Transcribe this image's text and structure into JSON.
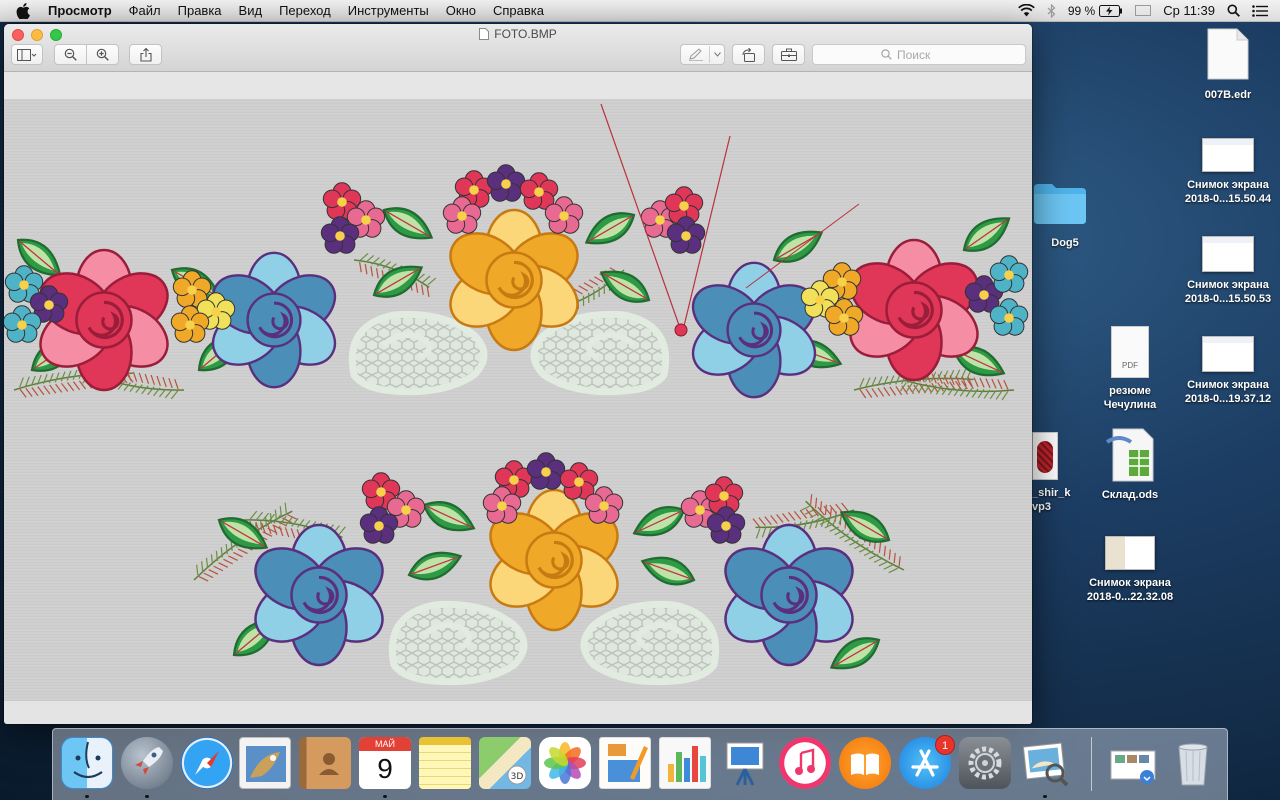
{
  "menubar": {
    "app_name": "Просмотр",
    "items": [
      "Файл",
      "Правка",
      "Вид",
      "Переход",
      "Инструменты",
      "Окно",
      "Справка"
    ],
    "battery": "99 %",
    "clock": "Ср 11:39"
  },
  "window": {
    "title": "FOTO.BMP",
    "search_placeholder": "Поиск"
  },
  "desktop_icons": [
    {
      "label_lines": [
        "007B.edr"
      ]
    },
    {
      "label_lines": [
        "Снимок экрана",
        "2018-0...15.50.44"
      ]
    },
    {
      "label_lines": [
        "Dog5"
      ]
    },
    {
      "label_lines": [
        "Снимок экрана",
        "2018-0...15.50.53"
      ]
    },
    {
      "label_lines": [
        "резюме",
        "Чечулина"
      ],
      "badge": "PDF"
    },
    {
      "label_lines": [
        "Снимок экрана",
        "2018-0...19.37.12"
      ]
    },
    {
      "label_lines": [
        "_shir_k",
        "vp3"
      ]
    },
    {
      "label_lines": [
        "Склад.ods"
      ]
    },
    {
      "label_lines": [
        "Снимок экрана",
        "2018-0...22.32.08"
      ]
    }
  ],
  "dock": {
    "calendar_month": "МАЙ",
    "calendar_day": "9",
    "appstore_badge": "1",
    "apps": [
      "finder",
      "launchpad",
      "safari",
      "mail",
      "contacts",
      "calendar",
      "notes",
      "maps",
      "photos",
      "pages",
      "numbers",
      "keynote",
      "itunes",
      "ibooks",
      "app-store",
      "system-preferences",
      "preview",
      "downloads",
      "trash"
    ]
  },
  "colors": {
    "embroidery_red": "#e03658",
    "embroidery_blue": "#4b8fb8",
    "embroidery_purple": "#5a2f7e",
    "embroidery_gold": "#f0a828",
    "embroidery_green": "#2f9a45",
    "embroidery_white": "#e2ebe0"
  }
}
